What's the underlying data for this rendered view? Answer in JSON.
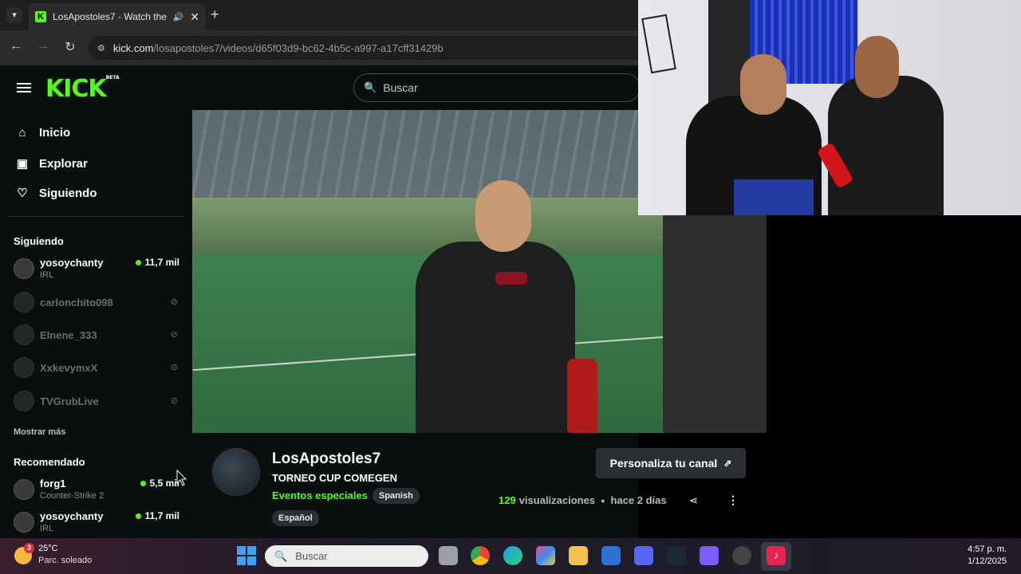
{
  "browser": {
    "tab_title": "LosApostoles7 - Watch the",
    "favicon_letter": "K",
    "url_host": "kick.com",
    "url_path": "/losapostoles7/videos/d65f03d9-bc62-4b5c-a997-a17cff31429b"
  },
  "kick": {
    "logo": "KICK",
    "logo_badge": "BETA",
    "search_placeholder": "Buscar",
    "nav": [
      {
        "label": "Inicio",
        "icon": "home-icon"
      },
      {
        "label": "Explorar",
        "icon": "browse-icon"
      },
      {
        "label": "Siguiendo",
        "icon": "heart-icon"
      }
    ],
    "following_header": "Siguiendo",
    "following": [
      {
        "name": "yosoychanty",
        "category": "IRL",
        "viewers": "11,7 mil",
        "live": true
      },
      {
        "name": "carlonchito098",
        "live": false
      },
      {
        "name": "Elnene_333",
        "live": false
      },
      {
        "name": "XxkevymxX",
        "live": false
      },
      {
        "name": "TVGrubLive",
        "live": false
      }
    ],
    "show_more": "Mostrar más",
    "recommended_header": "Recomendado",
    "recommended": [
      {
        "name": "forg1",
        "category": "Counter-Strike 2",
        "viewers": "5,5 mil"
      },
      {
        "name": "yosoychanty",
        "category": "IRL",
        "viewers": "11,7 mil"
      }
    ],
    "channel": {
      "name": "LosApostoles7",
      "video_title": "TORNEO CUP COMEGEN",
      "category": "Eventos especiales",
      "tags": [
        "Spanish",
        "Español"
      ],
      "customize_button": "Personaliza tu canal",
      "views_count": "129",
      "views_label": "visualizaciones",
      "age": "hace 2 días"
    }
  },
  "taskbar": {
    "temperature": "25°C",
    "weather": "Parc. soleado",
    "weather_badge": "3",
    "search_placeholder": "Buscar",
    "time": "4:57 p. m.",
    "date": "1/12/2025"
  },
  "colors": {
    "accent": "#53fc18",
    "page_bg": "#0b0e0f"
  }
}
